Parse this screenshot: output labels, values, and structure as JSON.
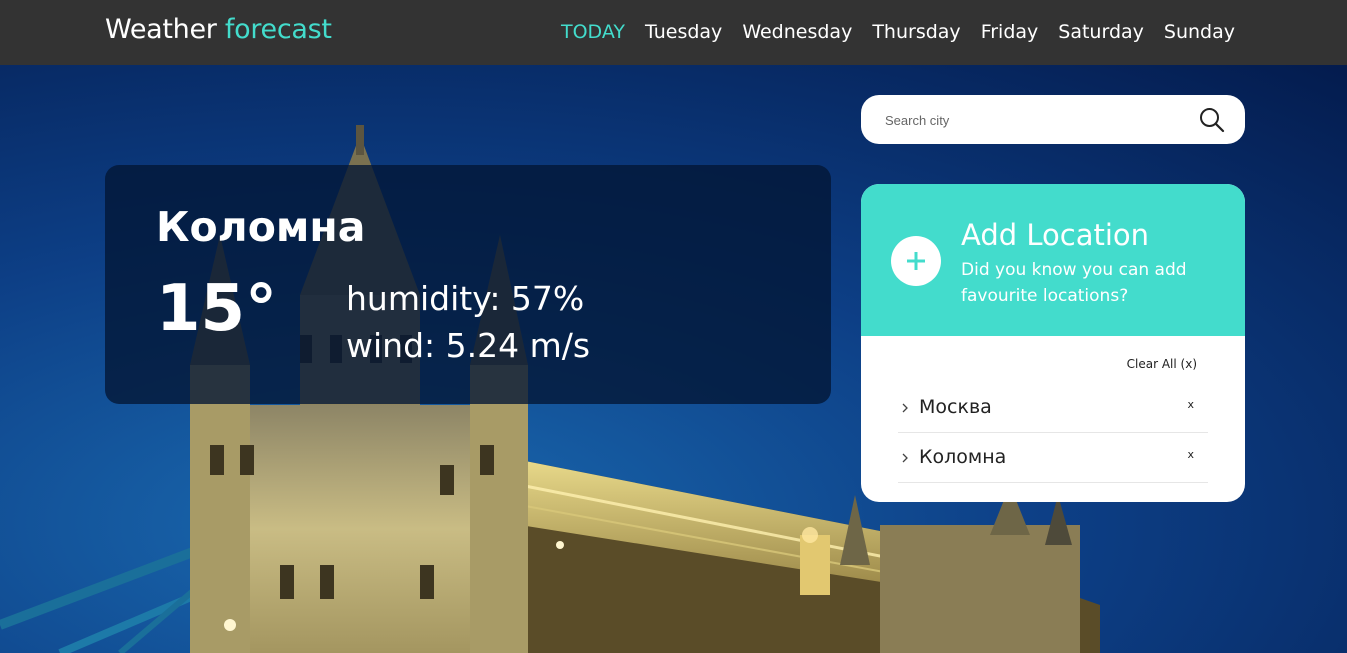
{
  "header": {
    "brand_main": "Weather",
    "brand_accent": "forecast",
    "nav": [
      {
        "label": "TODAY",
        "active": true
      },
      {
        "label": "Tuesday",
        "active": false
      },
      {
        "label": "Wednesday",
        "active": false
      },
      {
        "label": "Thursday",
        "active": false
      },
      {
        "label": "Friday",
        "active": false
      },
      {
        "label": "Saturday",
        "active": false
      },
      {
        "label": "Sunday",
        "active": false
      }
    ]
  },
  "current": {
    "city": "Коломна",
    "temperature": "15°",
    "humidity": "humidity: 57%",
    "wind": "wind: 5.24 m/s"
  },
  "search": {
    "placeholder": "Search city",
    "value": "",
    "icon": "search-icon"
  },
  "locations": {
    "title": "Add Location",
    "subtitle": "Did you know you can add favourite locations?",
    "add_icon": "plus-icon",
    "clear_all": "Clear All (x)",
    "items": [
      {
        "name": "Москва",
        "remove": "x"
      },
      {
        "name": "Коломна",
        "remove": "x"
      }
    ]
  },
  "colors": {
    "accent": "#43dccc",
    "header_bg": "#333333",
    "card_bg": "#021634"
  }
}
